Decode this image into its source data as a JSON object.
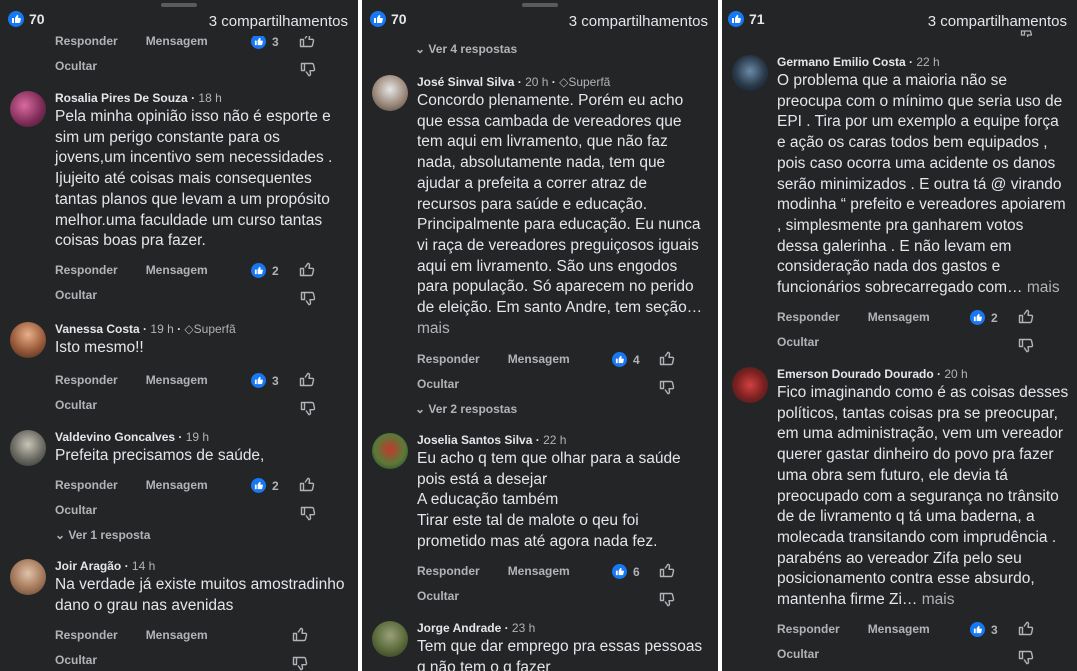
{
  "actions": {
    "reply": "Responder",
    "message": "Mensagem",
    "hide": "Ocultar"
  },
  "panel1": {
    "reactions": "70",
    "shares": "3 compartilhamentos",
    "prev_likes": "3",
    "comments": [
      {
        "name": "Rosalia Pires De Souza",
        "time": "18 h",
        "badge": "",
        "text": "Pela minha opinião isso não é esporte e sim um perigo constante para os jovens,um incentivo sem necessidades . Ijujeito até coisas mais consequentes tantas planos que levam a um propósito melhor.uma faculdade um curso tantas coisas boas pra fazer.",
        "likes": "2"
      },
      {
        "name": "Vanessa Costa",
        "time": "19 h",
        "badge": "Superfã",
        "text": "Isto mesmo!!",
        "likes": "3"
      },
      {
        "name": "Valdevino Goncalves",
        "time": "19 h",
        "badge": "",
        "text": "Prefeita precisamos de saúde,",
        "likes": "2",
        "replies": "Ver 1 resposta"
      },
      {
        "name": "Joir Aragão",
        "time": "14 h",
        "badge": "",
        "text": "Na verdade já existe muitos amostradinho dano o grau nas avenidas",
        "likes": ""
      }
    ]
  },
  "panel2": {
    "reactions": "70",
    "shares": "3 compartilhamentos",
    "top_replies": "Ver 4 respostas",
    "comments": [
      {
        "name": "José Sinval Silva",
        "time": "20 h",
        "badge": "Superfã",
        "text": "Concordo plenamente. Porém eu acho que essa cambada de vereadores que tem aqui em livramento, que não faz nada, absolutamente nada, tem que ajudar a prefeita a correr atraz de recursos para saúde e educação. Principalmente para educação. Eu nunca vi raça de vereadores preguiçosos iguais aqui em livramento. São uns engodos para população. Só aparecem no perido de eleição. Em santo Andre, tem seção…",
        "more": "mais",
        "likes": "4",
        "replies": "Ver 2 respostas"
      },
      {
        "name": "Joselia Santos Silva",
        "time": "22 h",
        "badge": "",
        "text_lines": [
          "Eu acho q tem que olhar para a saúde pois está a desejar",
          "A educação também",
          "Tirar este tal de malote o qeu foi prometido mas até agora nada fez."
        ],
        "likes": "6"
      },
      {
        "name": "Jorge Andrade",
        "time": "23 h",
        "badge": "",
        "text": "Tem que dar emprego pra essas pessoas q não tem o q fazer",
        "likes": ""
      }
    ]
  },
  "panel3": {
    "reactions": "71",
    "shares": "3 compartilhamentos",
    "comments": [
      {
        "name": "Germano Emilio Costa",
        "time": "22 h",
        "badge": "",
        "text": "O problema que a maioria não se preocupa com o mínimo que seria uso de EPI . Tira por um exemplo a equipe força e ação os caras todos bem equipados , pois caso ocorra uma acidente os danos serão minimizados . E outra tá @ virando modinha “ prefeito e vereadores apoiarem , simplesmente pra ganharem votos dessa galerinha . E não levam em consideração nada dos gastos e funcionários sobrecarregado com…",
        "more": "mais",
        "likes": "2"
      },
      {
        "name": "Emerson Dourado Dourado",
        "time": "20 h",
        "badge": "",
        "text": "Fico imaginando como é as coisas desses políticos, tantas coisas pra se preocupar, em uma administração, vem um vereador querer gastar dinheiro do povo pra fazer uma obra sem futuro, ele devia tá preocupado com a segurança no trânsito de de livramento q tá uma baderna, a molecada transitando com imprudência . parabéns ao vereador Zifa pelo seu posicionamento contra esse absurdo,  mantenha firme Zi…",
        "more": "mais",
        "likes": "3"
      }
    ]
  },
  "colors": {
    "background": "#242526",
    "text": "#e4e6eb",
    "muted": "#b0b3b8",
    "like_blue": "#1877f2"
  },
  "icons": [
    "like-icon",
    "thumbs-up-icon",
    "thumbs-down-icon",
    "chevron-down-icon",
    "superfan-diamond-icon"
  ]
}
